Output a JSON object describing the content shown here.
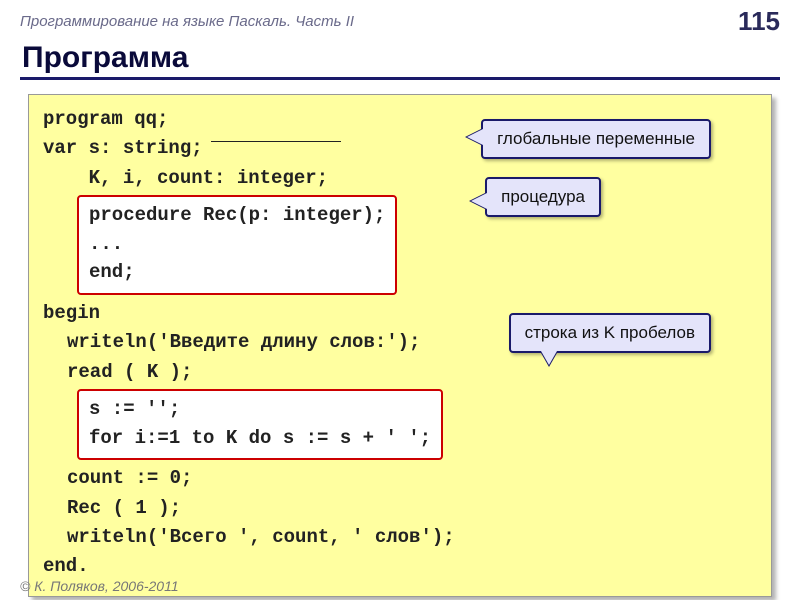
{
  "header": {
    "subject": "Программирование на языке Паскаль. Часть II",
    "page": "115"
  },
  "title": "Программа",
  "code": {
    "l1": "program qq;",
    "l2": "var s: string;",
    "l3": "    K, i, count: integer;",
    "box1": {
      "b1": "procedure Rec(p: integer);",
      "b2": "...",
      "b3": "end;"
    },
    "l4": "begin",
    "l5": "writeln('Введите длину слов:');",
    "l6": "read ( K );",
    "box2": {
      "b1": "s := '';",
      "b2": "for i:=1 to K do s := s + ' ';"
    },
    "l7": "count := 0;",
    "l8": "Rec ( 1 );",
    "l9": "writeln('Всего ', count, ' слов');",
    "l10": "end."
  },
  "callouts": {
    "c1": "глобальные переменные",
    "c2": "процедура",
    "c3": "строка из K пробелов"
  },
  "footer": "© К. Поляков, 2006-2011"
}
